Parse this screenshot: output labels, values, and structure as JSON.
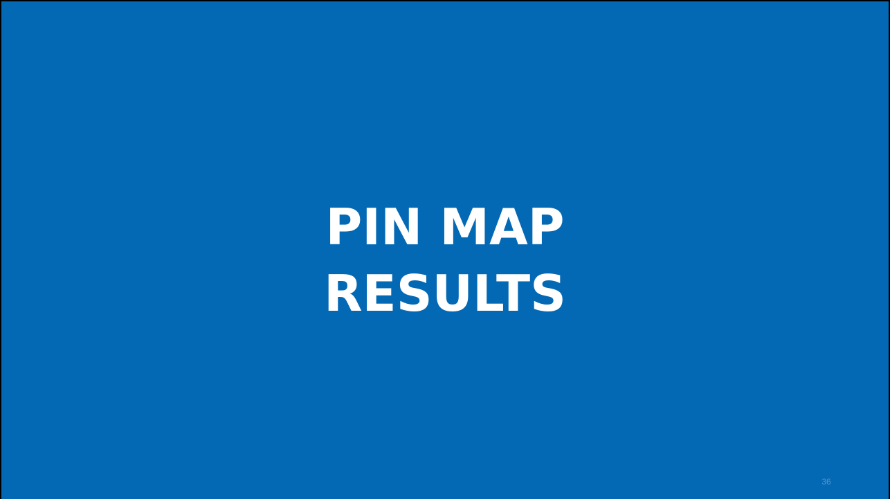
{
  "slide": {
    "title_lines": [
      "PIN MAP",
      "RESULTS"
    ],
    "slide_number": "36"
  },
  "colors": {
    "background": "#0469B4",
    "title_text": "#FFFFFF",
    "slide_number_text": "#5A93C9",
    "border": "#000000"
  }
}
